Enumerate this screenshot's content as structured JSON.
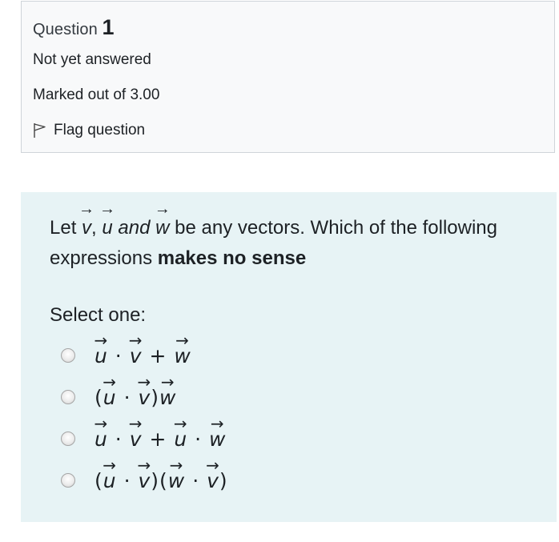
{
  "info": {
    "question_prefix": "Question",
    "question_number": "1",
    "state": "Not yet answered",
    "grade": "Marked out of 3.00",
    "flag_label": "Flag question"
  },
  "question": {
    "text_let": "Let ",
    "var_v": "v",
    "comma": ", ",
    "var_u": "u",
    "and_word": " and ",
    "var_w": "w",
    "text_rest": " be any vectors. Which of the following expressions ",
    "text_bold": "makes no sense",
    "select_label": "Select one:"
  },
  "options": [
    {
      "text": "u·v+w"
    },
    {
      "text": "(u·v)w"
    },
    {
      "text": "u·v+u·w"
    },
    {
      "text": "(u·v)(w·v)"
    }
  ],
  "icons": {
    "flag": "flag-icon",
    "radio": "radio-icon"
  },
  "colors": {
    "info_bg": "#f8f9fa",
    "content_bg": "#e7f3f5"
  }
}
